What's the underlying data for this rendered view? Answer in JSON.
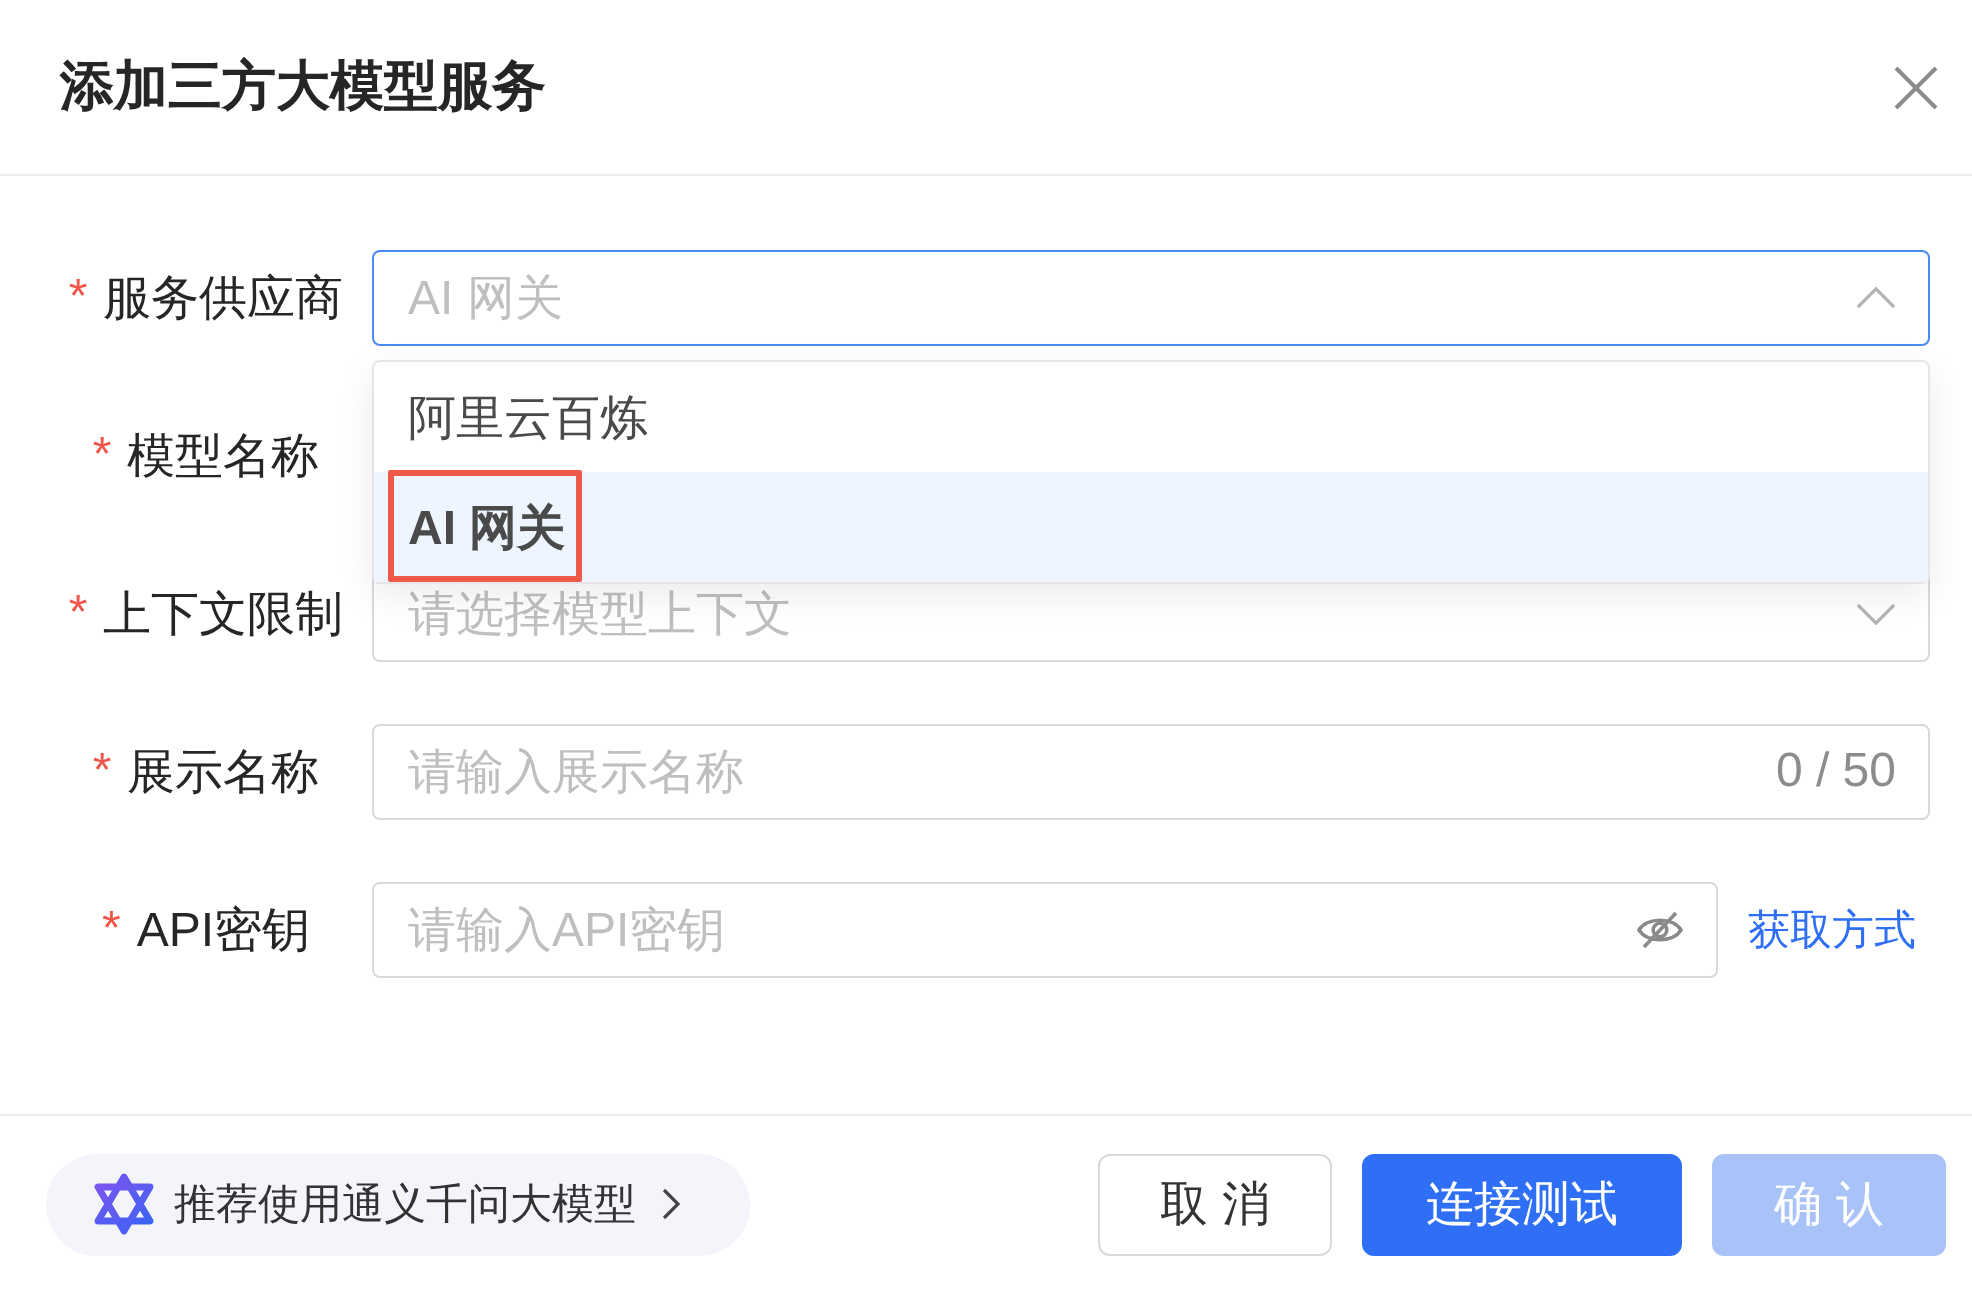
{
  "dialog": {
    "title": "添加三方大模型服务"
  },
  "form": {
    "fields": [
      {
        "required_mark": "*",
        "label": "服务供应商",
        "kind": "select",
        "value": "AI 网关",
        "expanded": true,
        "focused": true
      },
      {
        "required_mark": "*",
        "label": "模型名称",
        "kind": "covered"
      },
      {
        "required_mark": "*",
        "label": "上下文限制",
        "kind": "select",
        "placeholder": "请选择模型上下文",
        "expanded": false,
        "focused": false
      },
      {
        "required_mark": "*",
        "label": "展示名称",
        "kind": "text",
        "placeholder": "请输入展示名称",
        "counter": "0 / 50",
        "focused": false
      },
      {
        "required_mark": "*",
        "label": "API密钥",
        "kind": "password",
        "placeholder": "请输入API密钥",
        "link": "获取方式",
        "focused": false
      }
    ],
    "dropdown": {
      "options": [
        {
          "label": "阿里云百炼",
          "selected": false,
          "annotated": false
        },
        {
          "label": "AI 网关",
          "selected": true,
          "annotated": true
        }
      ]
    }
  },
  "footer": {
    "recommendation": "推荐使用通义千问大模型",
    "buttons": [
      {
        "label": "取 消",
        "kind": "default",
        "disabled": false
      },
      {
        "label": "连接测试",
        "kind": "primary",
        "disabled": false
      },
      {
        "label": "确 认",
        "kind": "primary",
        "disabled": true
      }
    ]
  }
}
